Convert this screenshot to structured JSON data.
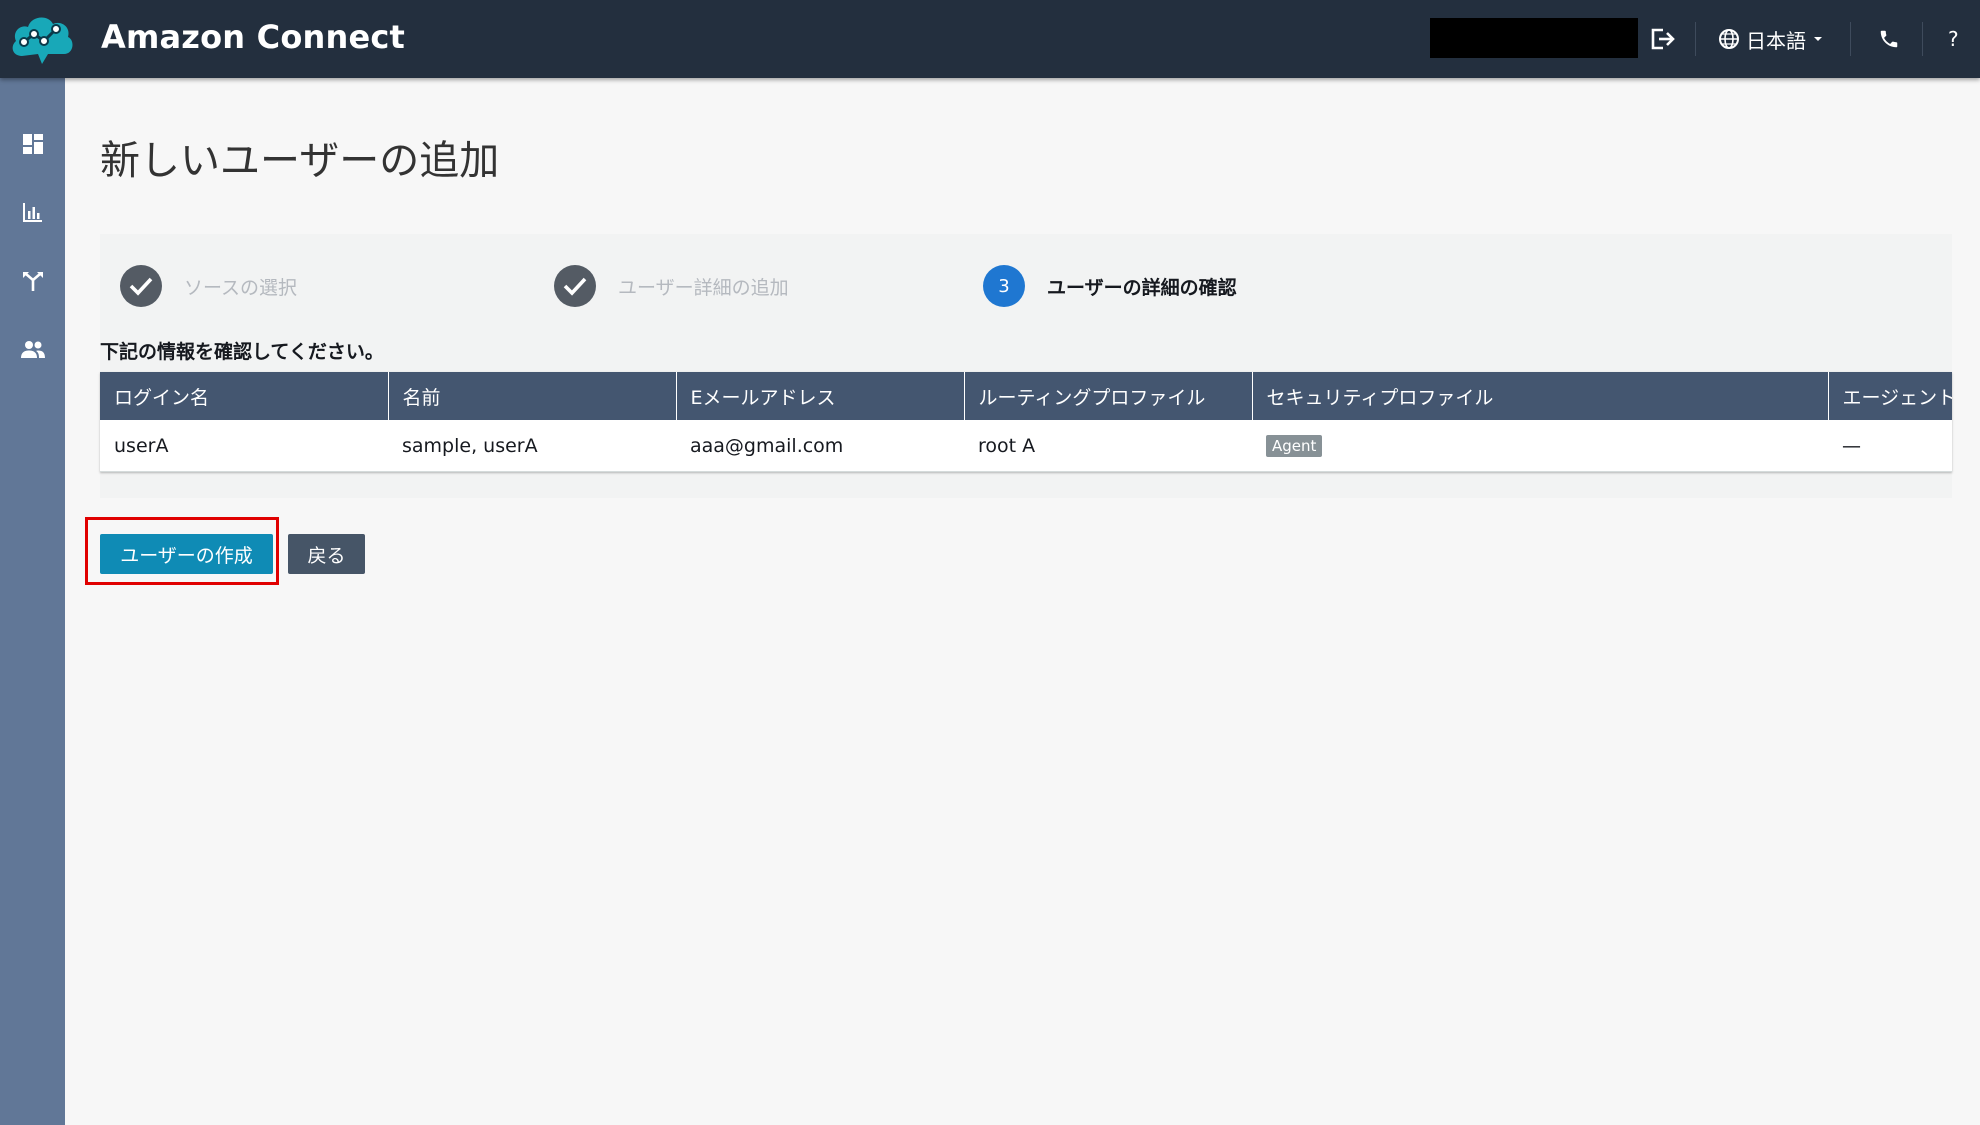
{
  "header": {
    "app_title": "Amazon Connect",
    "language_label": "日本語",
    "help_label": "?",
    "icons": {
      "logo": "amazon-connect-logo",
      "logout": "logout-icon",
      "globe": "globe-icon",
      "phone": "phone-icon"
    },
    "colors": {
      "background": "#232f3e"
    }
  },
  "sidebar": {
    "items": [
      {
        "icon": "dashboard-icon"
      },
      {
        "icon": "metrics-icon"
      },
      {
        "icon": "routing-icon"
      },
      {
        "icon": "users-icon"
      }
    ],
    "color": "#617797"
  },
  "page": {
    "title": "新しいユーザーの追加"
  },
  "wizard": {
    "steps": [
      {
        "label": "ソースの選択",
        "state": "completed"
      },
      {
        "label": "ユーザー詳細の追加",
        "state": "completed"
      },
      {
        "number": "3",
        "label": "ユーザーの詳細の確認",
        "state": "active"
      }
    ],
    "instruction": "下記の情報を確認してください。"
  },
  "table": {
    "columns": [
      "ログイン名",
      "名前",
      "Eメールアドレス",
      "ルーティングプロファイル",
      "セキュリティプロファイル",
      "エージェント"
    ],
    "rows": [
      {
        "login": "userA",
        "name": "sample, userA",
        "email": "aaa@gmail.com",
        "routing_profile": "root A",
        "security_profile": "Agent",
        "agent": "—"
      }
    ],
    "header_color": "#445670"
  },
  "actions": {
    "create_label": "ユーザーの作成",
    "back_label": "戻る",
    "create_color": "#0f8bb5",
    "back_color": "#465567",
    "highlight_color": "#e00000"
  }
}
